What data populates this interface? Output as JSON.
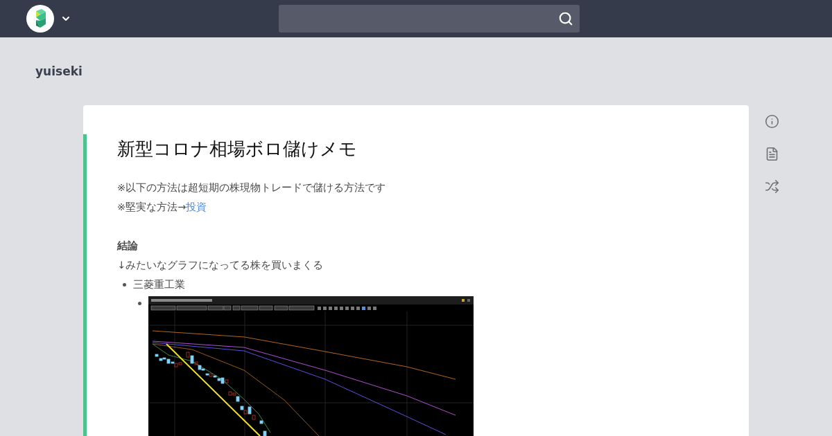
{
  "user": {
    "name": "yuiseki"
  },
  "article": {
    "title": "新型コロナ相場ボロ儲けメモ",
    "notes": [
      {
        "text": "※以下の方法は超短期の株現物トレードで儲ける方法です"
      },
      {
        "text": "※堅実な方法→",
        "link": "投資"
      }
    ],
    "heading": "結論",
    "intro": "↓みたいなグラフになってる株を買いまくる",
    "list": [
      {
        "text": "三菱重工業",
        "children": [
          {
            "kind": "image"
          }
        ]
      }
    ]
  }
}
